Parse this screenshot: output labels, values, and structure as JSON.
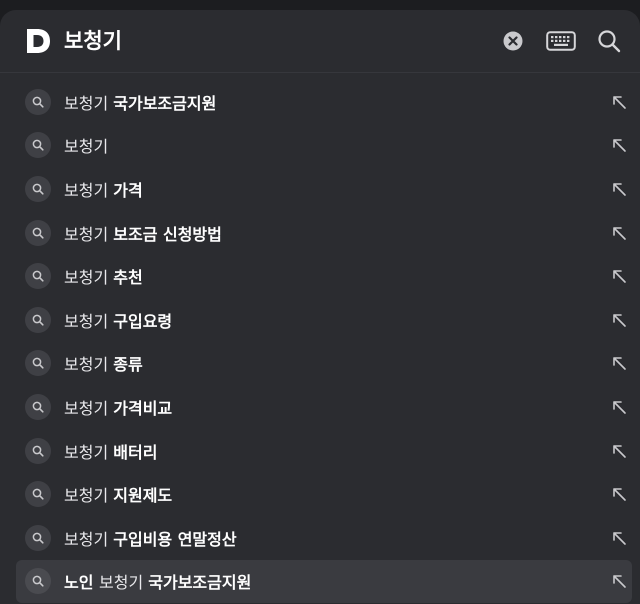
{
  "search": {
    "query": "보청기"
  },
  "suggestions": [
    {
      "prefix": "보청기",
      "suffix": "국가보조금지원"
    },
    {
      "prefix": "보청기",
      "suffix": ""
    },
    {
      "prefix": "보청기",
      "suffix": "가격"
    },
    {
      "prefix": "보청기",
      "suffix": "보조금 신청방법"
    },
    {
      "prefix": "보청기",
      "suffix": "추천"
    },
    {
      "prefix": "보청기",
      "suffix": "구입요령"
    },
    {
      "prefix": "보청기",
      "suffix": "종류"
    },
    {
      "prefix": "보청기",
      "suffix": "가격비교"
    },
    {
      "prefix": "보청기",
      "suffix": "배터리"
    },
    {
      "prefix": "보청기",
      "suffix": "지원제도"
    },
    {
      "prefix": "보청기",
      "suffix": "구입비용 연말정산"
    },
    {
      "lead": "노인",
      "prefix": "보청기",
      "suffix": "국가보조금지원",
      "selected": true
    }
  ],
  "colors": {
    "panel": "#2b2c30",
    "text": "#e9e9ec",
    "icon": "#d6d6d9"
  },
  "icons": {
    "logo": "daum-d-logo",
    "clear": "clear-icon",
    "keyboard": "keyboard-icon",
    "search": "search-icon",
    "suggestion": "search-icon",
    "fill": "arrow-up-left-icon"
  }
}
